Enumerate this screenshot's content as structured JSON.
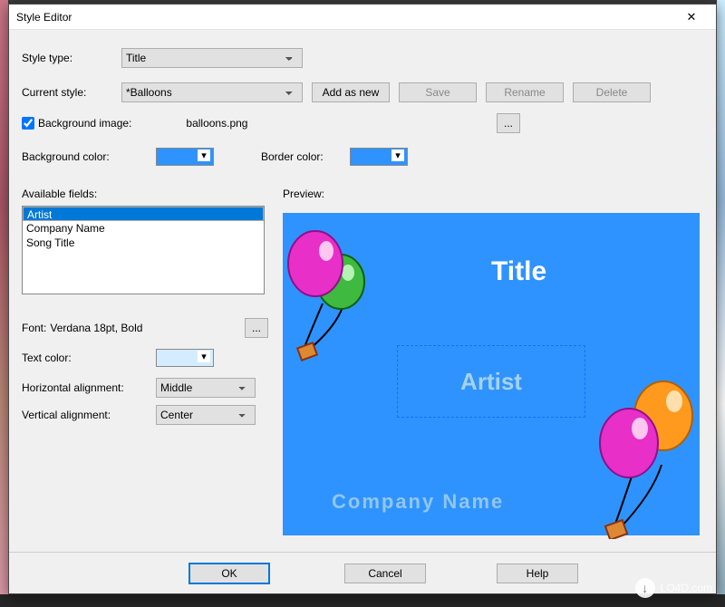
{
  "window": {
    "title": "Style Editor",
    "close_x": "✕"
  },
  "labels": {
    "style_type": "Style type:",
    "current_style": "Current style:",
    "bg_image": "Background image:",
    "bg_color": "Background color:",
    "border_color": "Border color:",
    "available_fields": "Available fields:",
    "preview": "Preview:",
    "font_prefix": "Font:",
    "font_value": "Verdana 18pt, Bold",
    "text_color": "Text color:",
    "h_align": "Horizontal alignment:",
    "v_align": "Vertical alignment:"
  },
  "values": {
    "style_type": "Title",
    "current_style": "*Balloons",
    "bg_image_file": "balloons.png",
    "bg_image_checked": true,
    "bg_color": "#2f93ff",
    "border_color": "#2f93ff",
    "text_color": "#d4ecff",
    "h_align": "Middle",
    "v_align": "Center"
  },
  "buttons": {
    "add_as_new": "Add as new",
    "save": "Save",
    "rename": "Rename",
    "delete": "Delete",
    "browse": "...",
    "font_browse": "...",
    "ok": "OK",
    "cancel": "Cancel",
    "help": "Help"
  },
  "fields": {
    "items": [
      "Artist",
      "Company Name",
      "Song Title"
    ],
    "selected_index": 0
  },
  "preview": {
    "title": "Title",
    "artist": "Artist",
    "company": "Company  Name"
  },
  "watermark": {
    "text": "LO4D.com"
  }
}
